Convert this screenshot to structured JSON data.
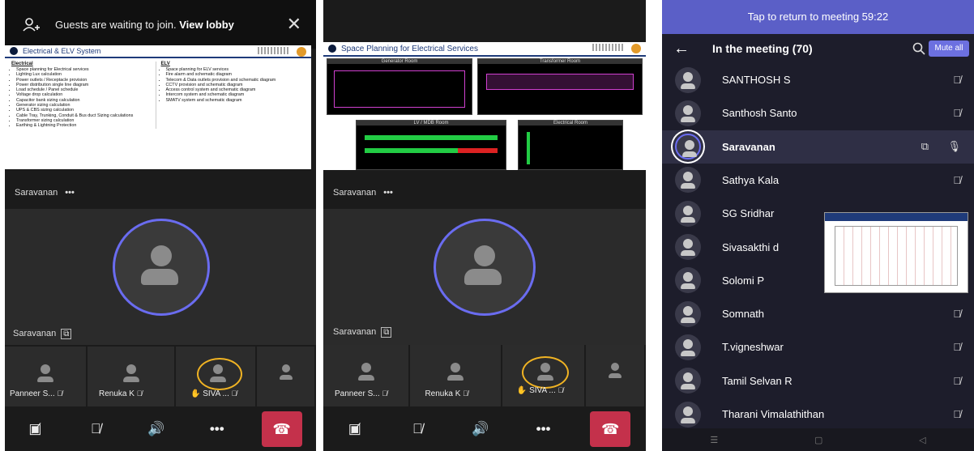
{
  "left": {
    "lobby_banner": "Guests are waiting to join.",
    "lobby_link": "View lobby",
    "slide_title": "Electrical & ELV System",
    "electrical_heading": "Electrical",
    "electrical_items": [
      "Space planning for Electrical services",
      "Lighting Lux calculation",
      "Power outlets / Receptacle provision",
      "Power distribution single line diagram",
      "Load schedule / Panel schedule",
      "Voltage drop calculation",
      "Capacitor bank sizing calculation",
      "Generator sizing calculation",
      "UPS & CBS sizing calculation",
      "Cable Tray, Trunking, Conduit & Bus duct Sizing calculations",
      "Transformer sizing calculation",
      "Earthing & Lightning Protection"
    ],
    "elv_heading": "ELV",
    "elv_items": [
      "Space planning for ELV services",
      "Fire alarm and schematic diagram",
      "Telecom & Data outlets provision and schematic diagram",
      "CCTV provision and schematic diagram",
      "Access control system and schematic diagram",
      "Intercom system and schematic diagram",
      "SMATV system and schematic diagram"
    ],
    "presenter_top": "Saravanan",
    "presenter_bottom": "Saravanan",
    "tiles": [
      "Panneer S...",
      "Renuka K",
      "SIVA ...",
      ""
    ]
  },
  "middle": {
    "slide_title": "Space Planning for Electrical Services",
    "diag_labels": [
      "Generator Room",
      "Transformer Room",
      "LV / MDB Room",
      "Electrical Room"
    ],
    "presenter_top": "Saravanan",
    "presenter_bottom": "Saravanan",
    "tiles": [
      "Panneer S...",
      "Renuka K",
      "SIVA ...",
      ""
    ]
  },
  "right": {
    "return_bar": "Tap to return to meeting 59:22",
    "meeting_title": "In the meeting (70)",
    "mute_all": "Mute all",
    "participants": [
      "SANTHOSH S",
      "Santhosh Santo",
      "Saravanan",
      "Sathya Kala",
      "SG Sridhar",
      "Sivasakthi d",
      "Solomi P",
      "Somnath",
      "T.vigneshwar",
      "Tamil Selvan R",
      "Tharani Vimalathithan"
    ]
  },
  "colors": {
    "accent": "#5b5fc7",
    "end_call": "#c4314b",
    "ring": "#6a6cf0",
    "hand": "#f0b323"
  },
  "icons": [
    "add-person-icon",
    "close-icon",
    "more-icon",
    "screen-share-icon",
    "mic-off-icon",
    "hand-raise-icon",
    "camera-off-icon",
    "speaker-icon",
    "end-call-icon",
    "back-arrow-icon",
    "search-icon",
    "mic-icon"
  ]
}
